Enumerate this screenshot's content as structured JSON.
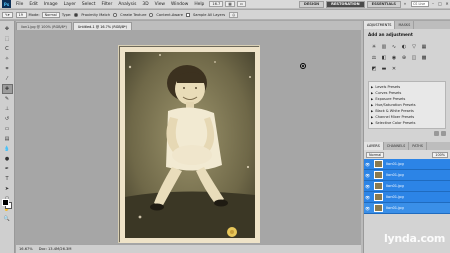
{
  "app": {
    "logo": "Ps"
  },
  "menu": [
    "File",
    "Edit",
    "Image",
    "Layer",
    "Select",
    "Filter",
    "Analysis",
    "3D",
    "View",
    "Window",
    "Help"
  ],
  "menubar_controls": {
    "zoom": "16.7"
  },
  "workspaces": [
    {
      "label": "DESIGN",
      "active": false
    },
    {
      "label": "RESTORATION",
      "active": true
    },
    {
      "label": "ESSENTIALS",
      "active": false
    }
  ],
  "search": {
    "placeholder": "CS Live"
  },
  "options": {
    "size": "19",
    "mode_label": "Mode:",
    "mode_value": "Normal",
    "type_label": "Type:",
    "proximity_match": "Proximity Match",
    "create_texture": "Create Texture",
    "content_aware": "Content-Aware",
    "sample_all_layers": "Sample All Layers"
  },
  "tabs": [
    {
      "label": "lion1.jpg @ 100% (RGB/8*)",
      "active": false
    },
    {
      "label": "Untitled-1 @ 16.7% (RGB/8*)",
      "active": true
    }
  ],
  "status": {
    "zoom": "16.67%",
    "doc": "Doc: 13.4M/26.3M"
  },
  "panels": {
    "top_tabs": [
      "ADJUSTMENTS",
      "MASKS"
    ],
    "adj_title": "Add an adjustment",
    "presets": [
      "Levels Presets",
      "Curves Presets",
      "Exposure Presets",
      "Hue/Saturation Presets",
      "Black & White Presets",
      "Channel Mixer Presets",
      "Selective Color Presets"
    ],
    "layer_tabs": [
      "LAYERS",
      "CHANNELS",
      "PATHS"
    ],
    "layer_mode": "Normal",
    "opacity": "100%",
    "layers": [
      "lion01.jpg",
      "lion01.jpg",
      "lion01.jpg",
      "lion01.jpg",
      "lion01.jpg"
    ]
  },
  "watermark": "lynda.com",
  "colors": {
    "accent": "#2c84e6",
    "active_workspace": "#4a4a4a",
    "canvas_bg": "#a6a6a6",
    "photo_sepia": "#efe3c8"
  },
  "icons": [
    "move-icon",
    "marquee-icon",
    "lasso-icon",
    "quick-select-icon",
    "crop-icon",
    "eyedropper-icon",
    "spot-heal-icon",
    "brush-icon",
    "clone-stamp-icon",
    "history-brush-icon",
    "eraser-icon",
    "gradient-icon",
    "blur-icon",
    "dodge-icon",
    "pen-icon",
    "type-icon",
    "path-select-icon",
    "shape-icon",
    "hand-icon",
    "zoom-icon"
  ]
}
